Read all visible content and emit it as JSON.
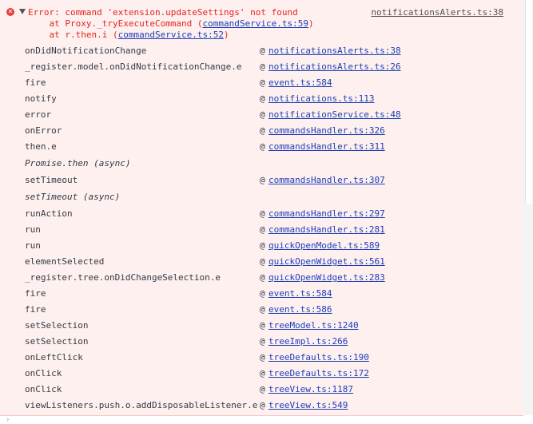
{
  "error": {
    "icon": "error-circle-icon",
    "message": "Error: command 'extension.updateSettings' not found",
    "source_link": "notificationsAlerts.ts:38",
    "lines": [
      {
        "prefix": "    at Proxy._tryExecuteCommand (",
        "link": "commandService.ts:59",
        "suffix": ")"
      },
      {
        "prefix": "    at r.then.i (",
        "link": "commandService.ts:52",
        "suffix": ")"
      }
    ]
  },
  "at_symbol": "@",
  "frames": [
    {
      "fn": "onDidNotificationChange",
      "link": "notificationsAlerts.ts:38"
    },
    {
      "fn": "_register.model.onDidNotificationChange.e",
      "link": "notificationsAlerts.ts:26"
    },
    {
      "fn": "fire",
      "link": "event.ts:584"
    },
    {
      "fn": "notify",
      "link": "notifications.ts:113"
    },
    {
      "fn": "error",
      "link": "notificationService.ts:48"
    },
    {
      "fn": "onError",
      "link": "commandsHandler.ts:326"
    },
    {
      "fn": "then.e",
      "link": "commandsHandler.ts:311"
    },
    {
      "async": "Promise.then (async)"
    },
    {
      "fn": "setTimeout",
      "link": "commandsHandler.ts:307"
    },
    {
      "async": "setTimeout (async)"
    },
    {
      "fn": "runAction",
      "link": "commandsHandler.ts:297"
    },
    {
      "fn": "run",
      "link": "commandsHandler.ts:281"
    },
    {
      "fn": "run",
      "link": "quickOpenModel.ts:589"
    },
    {
      "fn": "elementSelected",
      "link": "quickOpenWidget.ts:561"
    },
    {
      "fn": "_register.tree.onDidChangeSelection.e",
      "link": "quickOpenWidget.ts:283"
    },
    {
      "fn": "fire",
      "link": "event.ts:584"
    },
    {
      "fn": "fire",
      "link": "event.ts:586"
    },
    {
      "fn": "setSelection",
      "link": "treeModel.ts:1240"
    },
    {
      "fn": "setSelection",
      "link": "treeImpl.ts:266"
    },
    {
      "fn": "onLeftClick",
      "link": "treeDefaults.ts:190"
    },
    {
      "fn": "onClick",
      "link": "treeDefaults.ts:172"
    },
    {
      "fn": "onClick",
      "link": "treeView.ts:1187"
    },
    {
      "fn": "viewListeners.push.o.addDisposableListener.e",
      "link": "treeView.ts:549"
    }
  ],
  "colors": {
    "error_text": "#e0261f",
    "error_bg": "#fff0f0",
    "link": "#1a3fb5"
  }
}
